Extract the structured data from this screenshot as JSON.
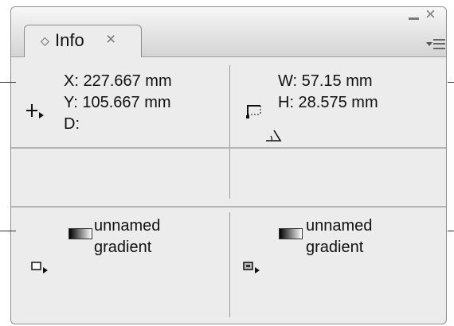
{
  "tab": {
    "label": "Info",
    "close_glyph": "×",
    "chevron_glyph": "◇"
  },
  "window": {
    "close_glyph": "×"
  },
  "position": {
    "x": "X: 227.667 mm",
    "y": "Y: 105.667 mm",
    "d": "D:"
  },
  "size": {
    "w": "W: 57.15 mm",
    "h": "H: 28.575 mm"
  },
  "fill": {
    "line1": "unnamed",
    "line2": "gradient"
  },
  "stroke": {
    "line1": "unnamed",
    "line2": "gradient"
  },
  "icons": {
    "position": "crosshair-icon",
    "size": "bounding-box-icon",
    "angle": "angle-icon",
    "fill": "fill-icon",
    "stroke": "stroke-icon"
  },
  "colors": {
    "panel_bg": "#ececec",
    "divider": "#b5b5b5"
  }
}
